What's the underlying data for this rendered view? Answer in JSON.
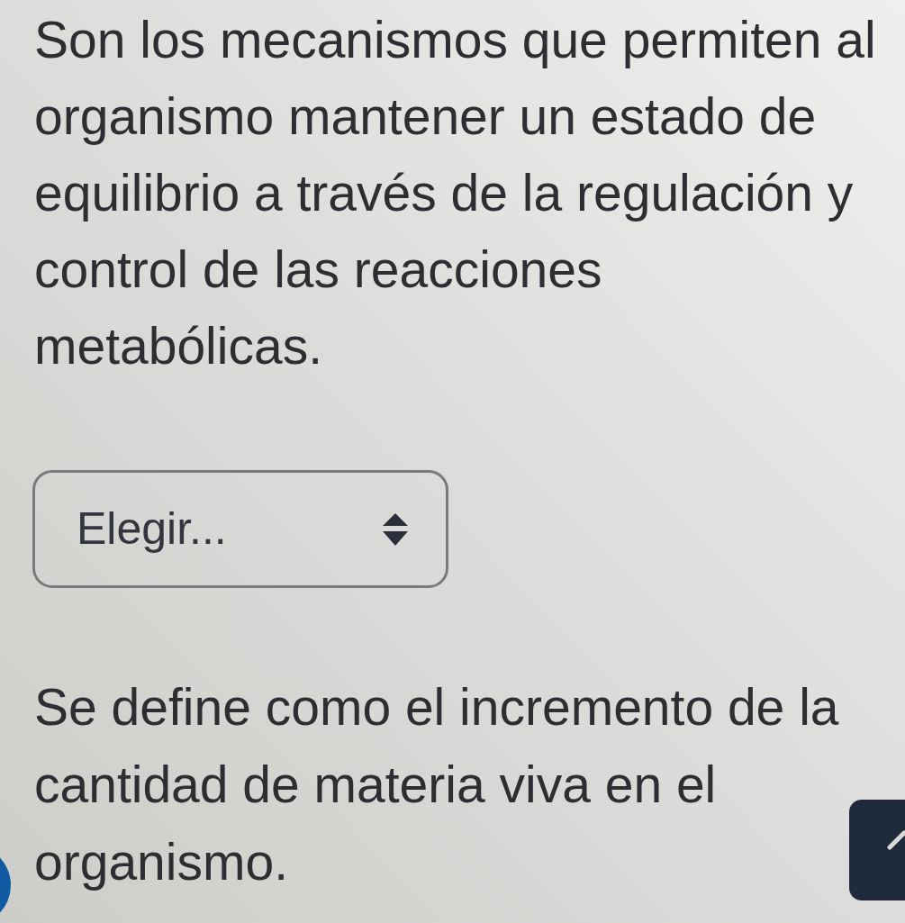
{
  "questions": [
    {
      "text": "Son los mecanismos que permiten al organismo mantener un estado de equilibrio a través de la regulación y control de las reacciones metabólicas.",
      "answer": {
        "placeholder": "Elegir..."
      }
    },
    {
      "text": "Se define como el incremento de la cantidad de materia viva en el organismo."
    }
  ]
}
